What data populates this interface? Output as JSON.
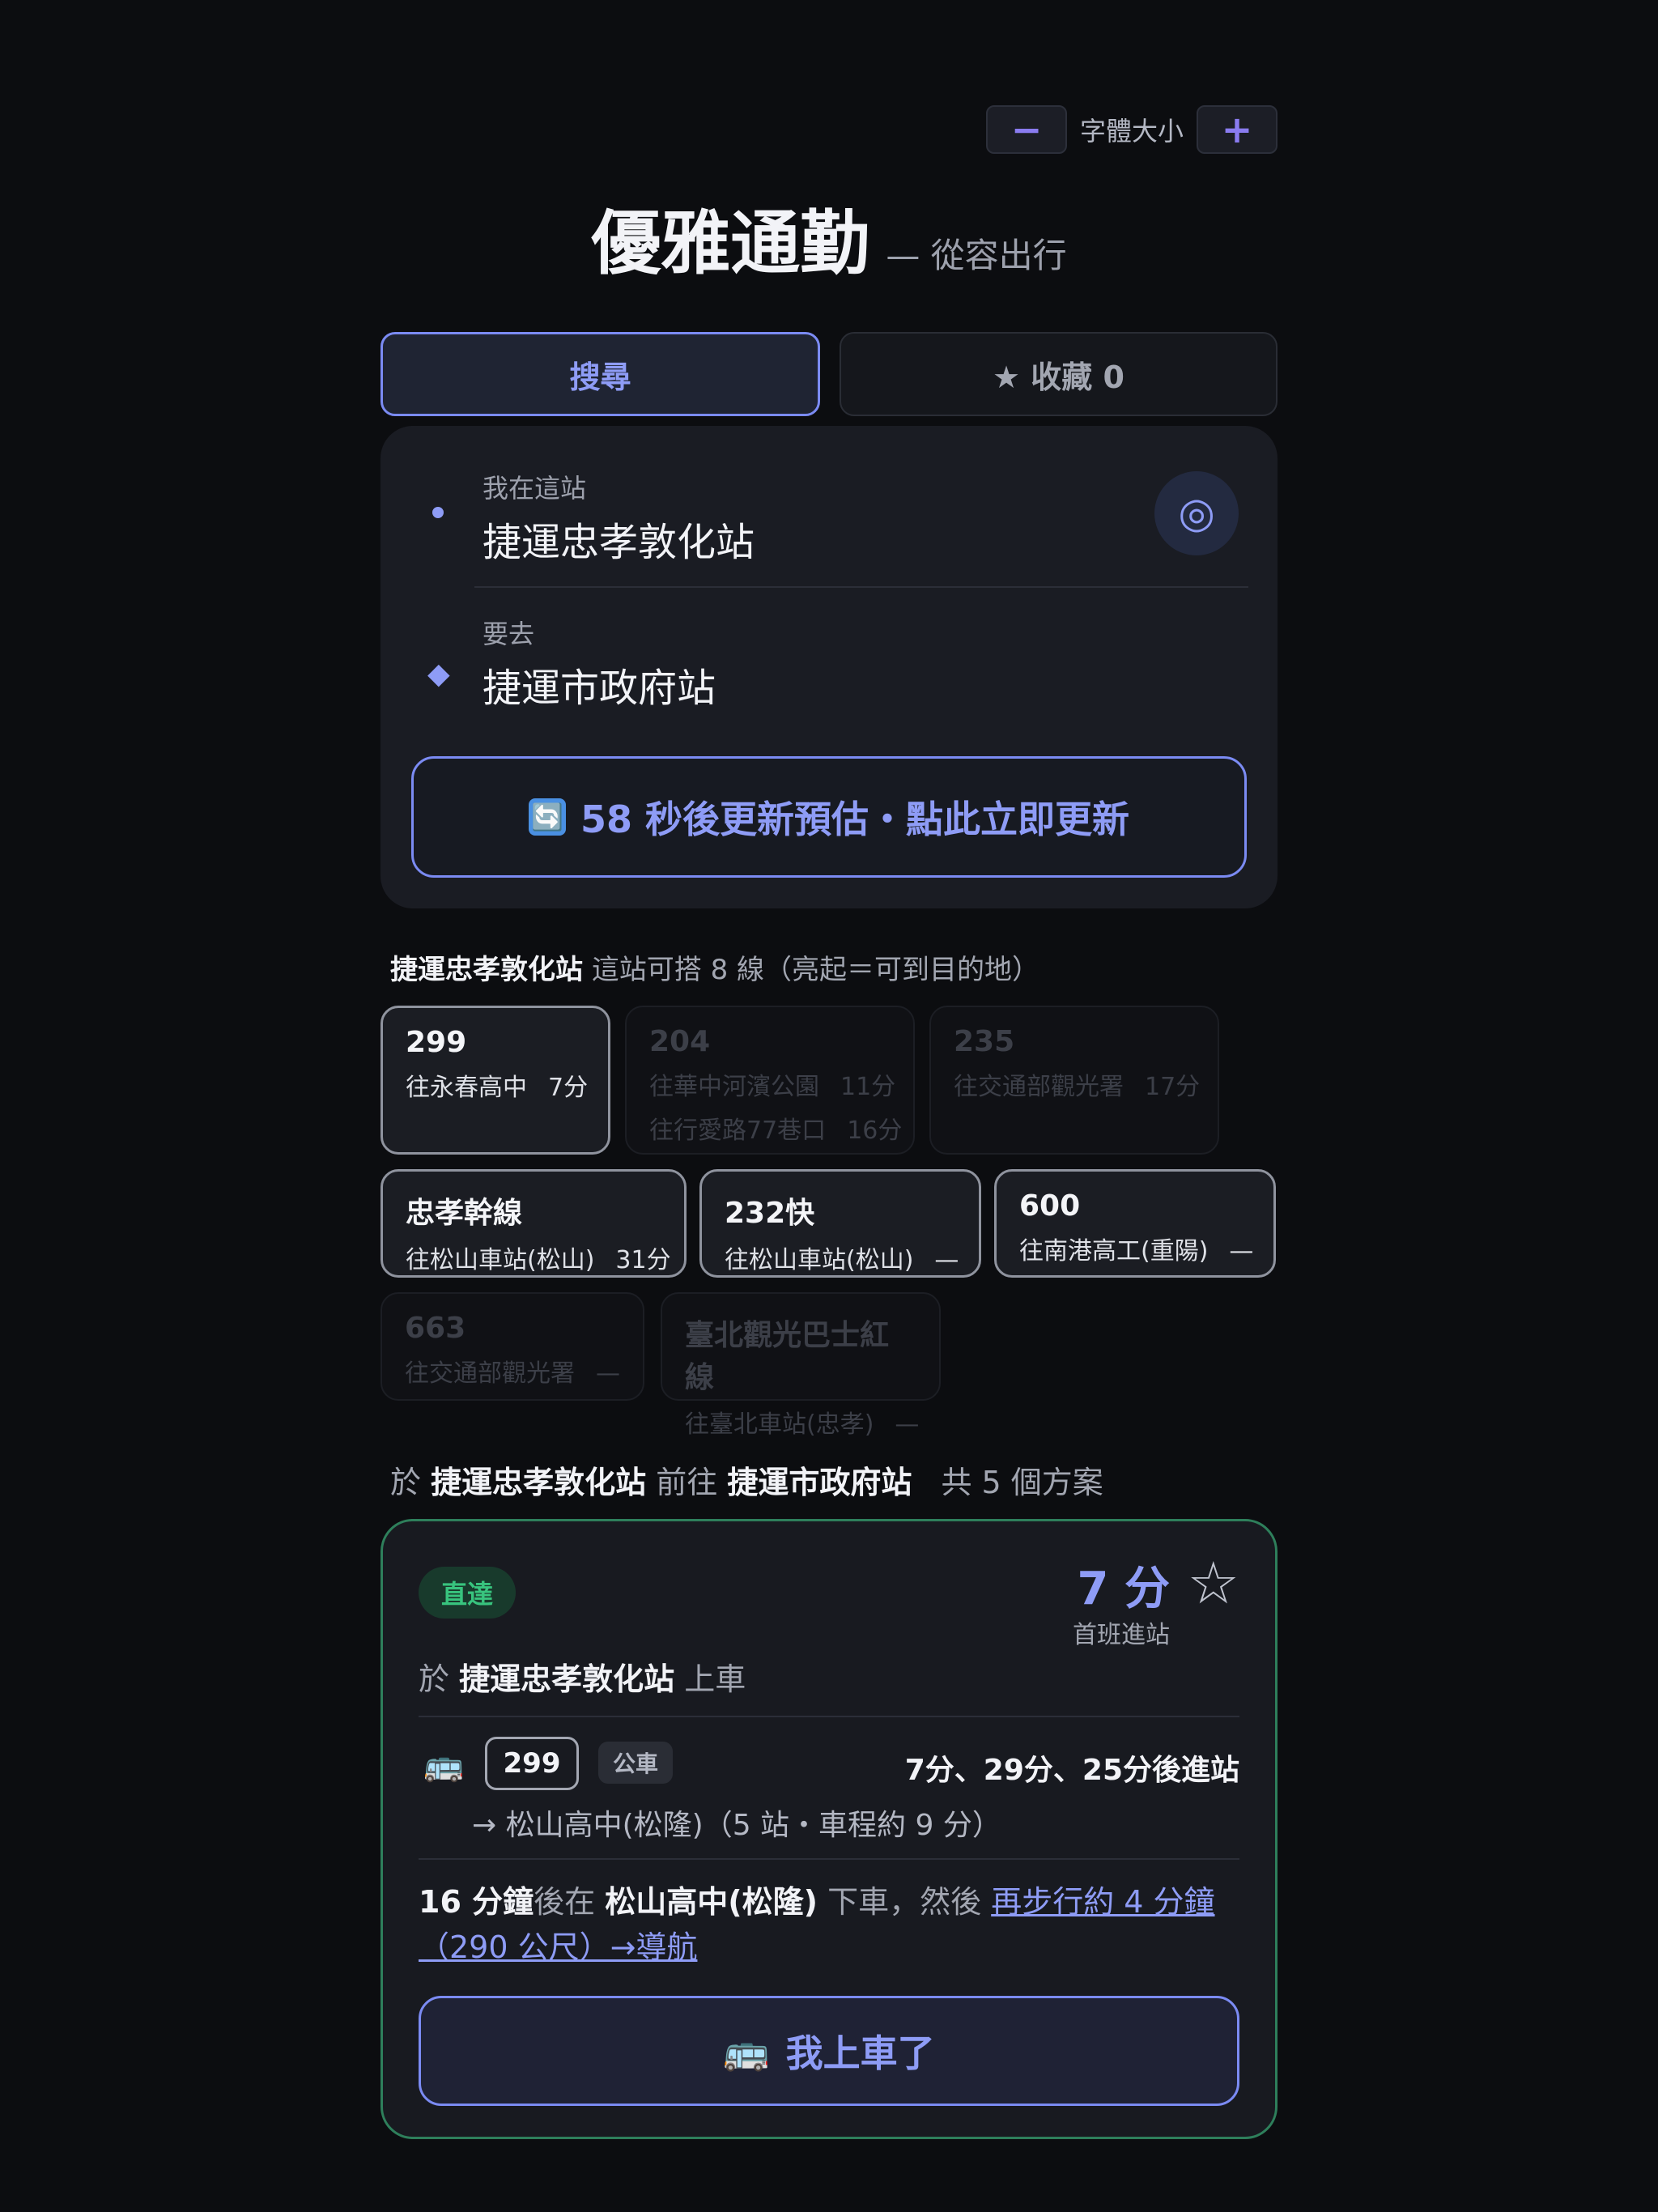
{
  "font_control": {
    "minus": "−",
    "label": "字體大小",
    "plus": "+"
  },
  "header": {
    "title": "優雅通勤",
    "subtitle": "— 從容出行"
  },
  "tabs": [
    {
      "label": "搜尋",
      "active": true
    },
    {
      "label": "★ 收藏 0",
      "active": false
    }
  ],
  "search": {
    "from_label": "我在這站",
    "from_value": "捷運忠孝敦化站",
    "to_label": "要去",
    "to_value": "捷運市政府站",
    "locate_icon": "◎",
    "to_marker": "◆",
    "refresh_icon": "🔄",
    "refresh_label": "58 秒後更新預估・點此立即更新"
  },
  "lines": {
    "station": "捷運忠孝敦化站",
    "summary": "這站可搭 8 線（亮起＝可到目的地）",
    "items": [
      {
        "num": "299",
        "d1": "往永春高中",
        "t1": "7分",
        "reachable": true
      },
      {
        "num": "204",
        "d1": "往華中河濱公園",
        "t1": "11分",
        "d2": "往行愛路77巷口",
        "t2": "16分",
        "reachable": false
      },
      {
        "num": "235",
        "d1": "往交通部觀光署",
        "t1": "17分",
        "reachable": false
      },
      {
        "num": "忠孝幹線",
        "d1": "往松山車站(松山)",
        "t1": "31分",
        "reachable": true
      },
      {
        "num": "232快",
        "d1": "往松山車站(松山)",
        "t1": "—",
        "reachable": true
      },
      {
        "num": "600",
        "d1": "往南港高工(重陽)",
        "t1": "—",
        "reachable": true
      },
      {
        "num": "663",
        "d1": "往交通部觀光署",
        "t1": "—",
        "reachable": false
      },
      {
        "num": "臺北觀光巴士紅線",
        "d1": "往臺北車站(忠孝)",
        "t1": "—",
        "reachable": false
      }
    ]
  },
  "plans": {
    "p1": "於",
    "from": "捷運忠孝敦化站",
    "p2": "前往",
    "to": "捷運市政府站",
    "count": "共 5 個方案"
  },
  "plan": {
    "badge": "直達",
    "eta": "7 分",
    "eta_sub": "首班進站",
    "star": "☆",
    "board_p1": "於",
    "board_station": "捷運忠孝敦化站",
    "board_p2": "上車",
    "bus_icon": "🚌",
    "route": "299",
    "type": "公車",
    "arrivals": "7分、29分、25分後進站",
    "route_dest": "→ 松山高中(松隆)（5 站・車程約 9 分）",
    "instr_time": "16 分鐘",
    "instr_p1": "後在",
    "instr_stop": "松山高中(松隆)",
    "instr_p2": "下車，然後",
    "instr_link": "再步行約 4 分鐘（290 公尺）→導航",
    "board_btn": "我上車了"
  },
  "colors": {
    "accent": "#8e9cf6",
    "success": "#38c47e",
    "bg": "#0c0d10"
  }
}
